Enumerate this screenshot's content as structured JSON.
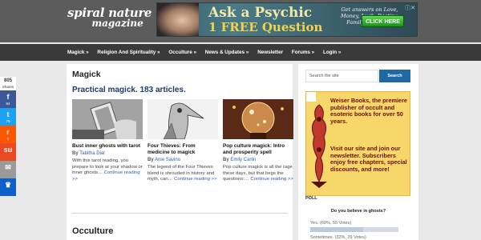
{
  "brand": {
    "line1": "spiral nature",
    "line2": "magazine"
  },
  "ad": {
    "headline": "Ask a Psychic",
    "offer": "1 FREE Question",
    "answers": "Get answers on Love, Money, Luck, Destiny, Family and more.",
    "button": "CLICK HERE",
    "close": "ⓘ✕"
  },
  "nav": {
    "items": [
      "Magick »",
      "Religion And Spirituality »",
      "Occulture »",
      "News & Updates »",
      "Newsletter",
      "Forums »",
      "Login »"
    ]
  },
  "main": {
    "title": "Magick",
    "tagline": "Practical magick. 183 articles.",
    "articles": [
      {
        "title": "Bust inner ghosts with tarot",
        "by": "By",
        "author": "Tabitha Dial",
        "excerpt": "With this tarot reading, you prepare to look at your shadow or inner ghosts… ",
        "more": "Continue reading >>"
      },
      {
        "title": "Four Thieves: From medicine to magick",
        "by": "By",
        "author": "Anie Savino",
        "excerpt": "The legend of the Four Thieves blend is shrouded in history and myth, can… ",
        "more": "Continue reading >>"
      },
      {
        "title": "Pop culture magick: Intro and prosperity spell",
        "by": "By",
        "author": "Emily Carlin",
        "excerpt": "Pop culture magick is all the rage these days, but that begs the questions:… ",
        "more": "Continue reading >>"
      }
    ],
    "next_section": "Occulture"
  },
  "sidebar": {
    "search_placeholder": "Search the site",
    "search_button": "Search",
    "weiser_top": "Weiser Books, the premiere publisher of occult and esoteric books for over 50 years.",
    "weiser_bottom": "Visit our site and join our newsletter. Subscribers enjoy free chapters, special discounts, and more!",
    "poll_label": "POLL",
    "poll_question": "Do you believe in ghosts?",
    "poll_answers": [
      {
        "label": "Yes. (60%, 55 Votes)",
        "fraction": 0.6
      },
      {
        "label": "Sometimes. (32%, 29 Votes)",
        "fraction": 0.32
      }
    ]
  },
  "share": {
    "count": "805",
    "count_label": "Shares",
    "buttons": [
      {
        "icon": "facebook-icon",
        "glyph": "f",
        "count": "84",
        "color": "#3b5998"
      },
      {
        "icon": "twitter-icon",
        "glyph": "t",
        "count": "79",
        "color": "#1da1f2"
      },
      {
        "icon": "reddit-icon",
        "glyph": "r",
        "count": "0",
        "color": "#ff5700"
      },
      {
        "icon": "stumbleupon-icon",
        "glyph": "su",
        "count": "",
        "color": "#eb4924"
      },
      {
        "icon": "email-icon",
        "glyph": "✉",
        "count": "",
        "color": "#9a9a9a"
      },
      {
        "icon": "sumo-crown-icon",
        "glyph": "♛",
        "count": "",
        "color": "#0e5fc9"
      }
    ]
  },
  "colors": {
    "nav_bg": "#3a3a3a",
    "header_bg": "#5c5c5c",
    "accent": "#1f6aa5",
    "tagline": "#1b3a6b",
    "weiser_bg": "#f8d76a"
  }
}
